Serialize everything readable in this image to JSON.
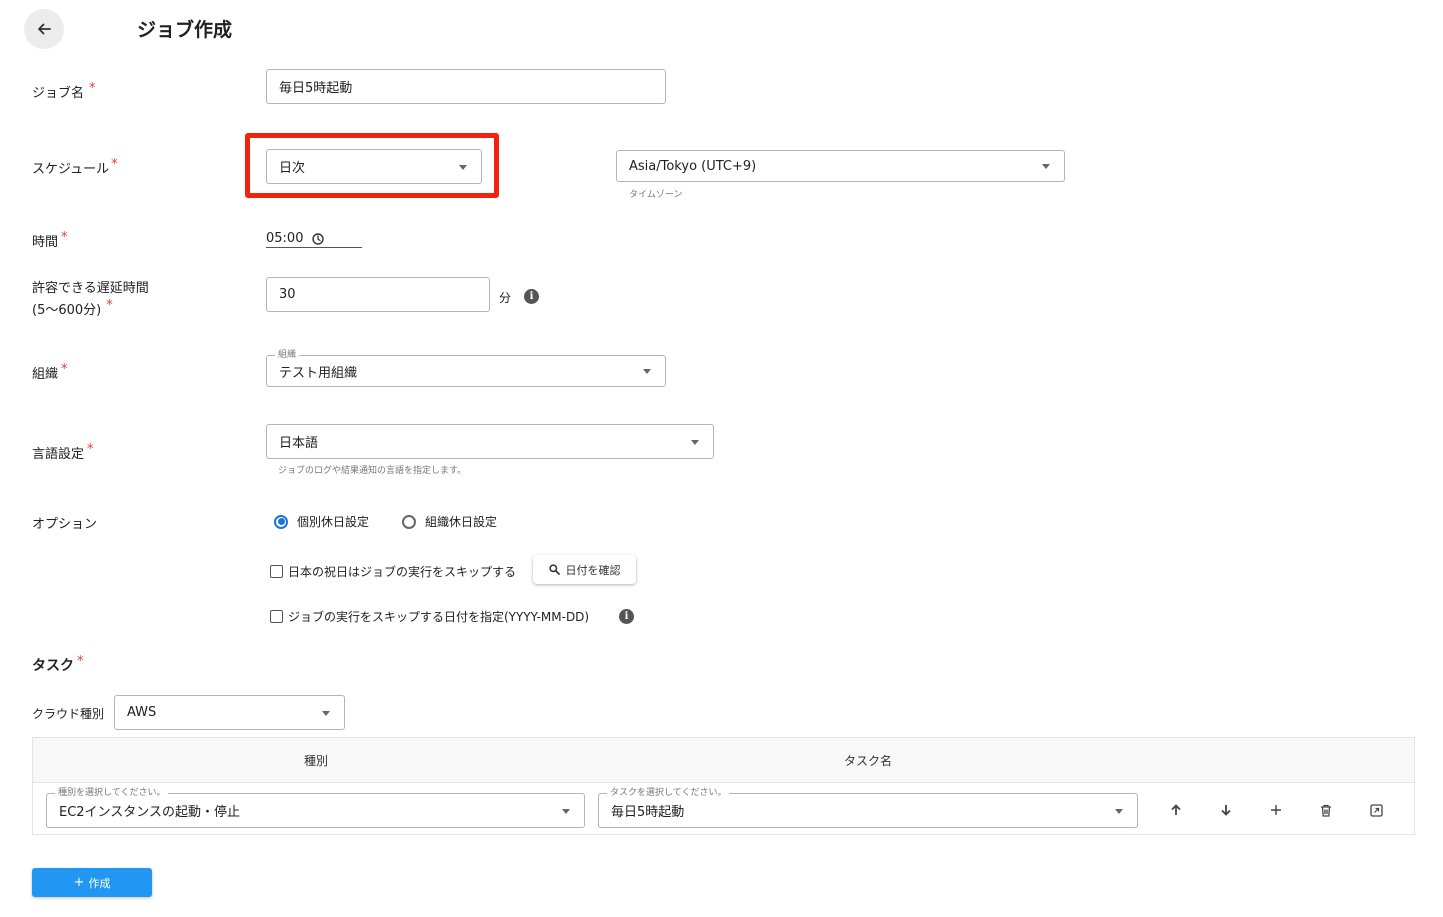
{
  "header": {
    "title": "ジョブ作成"
  },
  "form": {
    "job_name": {
      "label": "ジョブ名",
      "required": "*",
      "value": "毎日5時起動"
    },
    "schedule": {
      "label": "スケジュール",
      "required": "*",
      "value": "日次"
    },
    "timezone": {
      "value": "Asia/Tokyo (UTC+9)",
      "helper": "タイムゾーン"
    },
    "time": {
      "label": "時間",
      "required": "*",
      "value": "05:00"
    },
    "delay": {
      "label_line1": "許容できる遅延時間",
      "label_line2": "(5〜600分)",
      "required": "*",
      "value": "30",
      "unit": "分"
    },
    "org": {
      "label": "組織",
      "required": "*",
      "float_label": "組織",
      "value": "テスト用組織"
    },
    "language": {
      "label": "言語設定",
      "required": "*",
      "value": "日本語",
      "helper": "ジョブのログや結果通知の言語を指定します。"
    },
    "options": {
      "label": "オプション",
      "radio_individual": "個別休日設定",
      "radio_org": "組織休日設定",
      "selected": "individual",
      "check_holiday": "日本の祝日はジョブの実行をスキップする",
      "check_dates": "ジョブの実行をスキップする日付を指定(YYYY-MM-DD)",
      "check_date_button": "日付を確認"
    }
  },
  "tasks": {
    "title": "タスク",
    "required": "*",
    "cloud_label": "クラウド種別",
    "cloud_value": "AWS",
    "col_type": "種別",
    "col_name": "タスク名",
    "row": {
      "type_float": "種別を選択してください。",
      "type_value": "EC2インスタンスの起動・停止",
      "name_float": "タスクを選択してください。",
      "name_value": "毎日5時起動"
    }
  },
  "actions": {
    "create_label": "作成"
  },
  "colors": {
    "primary": "#2196f3",
    "required": "#e53935",
    "highlight": "#f4230d",
    "radio": "#1976d2"
  }
}
